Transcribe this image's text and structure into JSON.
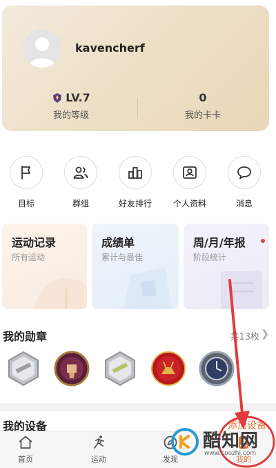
{
  "profile": {
    "username": "kavencherf",
    "level_value": "LV.7",
    "level_label": "我的等级",
    "cards_value": "0",
    "cards_label": "我的卡卡"
  },
  "shortcuts": [
    {
      "label": "目标",
      "icon": "flag-icon"
    },
    {
      "label": "群组",
      "icon": "group-icon"
    },
    {
      "label": "好友排行",
      "icon": "ranking-icon"
    },
    {
      "label": "个人资料",
      "icon": "profile-card-icon"
    },
    {
      "label": "消息",
      "icon": "message-icon"
    }
  ],
  "records": [
    {
      "title": "运动记录",
      "subtitle": "所有运动"
    },
    {
      "title": "成绩单",
      "subtitle": "累计与最佳"
    },
    {
      "title": "周/月/年报",
      "subtitle": "阶段统计"
    }
  ],
  "medals": {
    "title": "我的勋章",
    "count": "共13枚",
    "items": [
      {
        "icon": "silver-300-medal-icon"
      },
      {
        "icon": "fist-medal-icon"
      },
      {
        "icon": "silver-300-medal-icon"
      },
      {
        "icon": "red-reindeer-medal-icon"
      },
      {
        "icon": "watch-medal-icon"
      }
    ]
  },
  "devices": {
    "title": "我的设备",
    "add_label": "添加设备"
  },
  "bottom_nav": [
    {
      "label": "首页",
      "icon": "home-icon"
    },
    {
      "label": "运动",
      "icon": "runner-icon"
    },
    {
      "label": "发现",
      "icon": "discover-icon"
    },
    {
      "label": "我的",
      "icon": "me-icon"
    }
  ],
  "watermark": {
    "name": "酷知网",
    "url": "www.coozhi.com"
  },
  "colors": {
    "accent": "#e0733d",
    "annotation_red": "#e23b3b",
    "card_gold": "#ede0c8"
  }
}
